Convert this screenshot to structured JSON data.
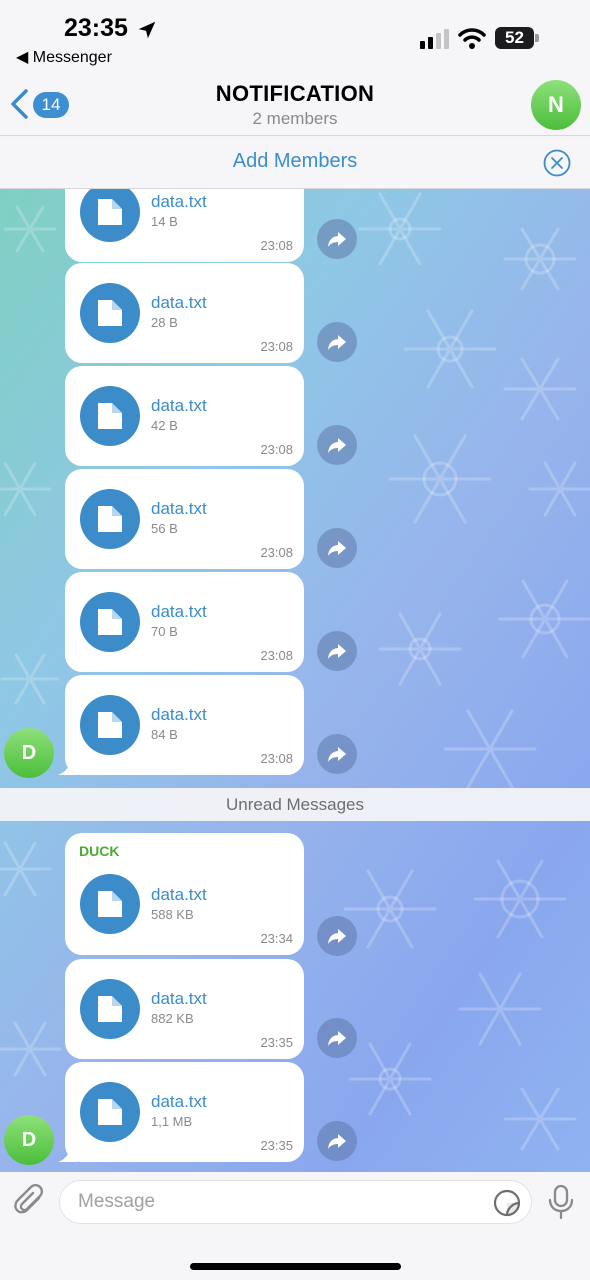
{
  "status_bar": {
    "time": "23:35",
    "back_app": "◀ Messenger",
    "battery": "52"
  },
  "header": {
    "back_badge": "14",
    "title": "NOTIFICATION",
    "subtitle": "2 members",
    "avatar_letter": "N"
  },
  "add_bar": {
    "label": "Add Members"
  },
  "messages_before": [
    {
      "name": "data.txt",
      "size": "14 B",
      "time": "23:08"
    },
    {
      "name": "data.txt",
      "size": "28 B",
      "time": "23:08"
    },
    {
      "name": "data.txt",
      "size": "42 B",
      "time": "23:08"
    },
    {
      "name": "data.txt",
      "size": "56 B",
      "time": "23:08"
    },
    {
      "name": "data.txt",
      "size": "70 B",
      "time": "23:08"
    },
    {
      "name": "data.txt",
      "size": "84 B",
      "time": "23:08"
    }
  ],
  "unread_label": "Unread Messages",
  "messages_after": [
    {
      "sender": "DUCK",
      "name": "data.txt",
      "size": "588 KB",
      "time": "23:34"
    },
    {
      "name": "data.txt",
      "size": "882 KB",
      "time": "23:35"
    },
    {
      "name": "data.txt",
      "size": "1,1 MB",
      "time": "23:35"
    }
  ],
  "sender_avatar_letter": "D",
  "input": {
    "placeholder": "Message"
  },
  "colors": {
    "accent": "#3b8cc8",
    "sender": "#4aab33",
    "avatar_green": "#5cc94a"
  },
  "icons": [
    "location-arrow-icon",
    "signal-icon",
    "wifi-icon",
    "battery-icon",
    "back-chevron-icon",
    "close-circle-icon",
    "file-icon",
    "forward-icon",
    "attach-icon",
    "sticker-icon",
    "mic-icon"
  ]
}
